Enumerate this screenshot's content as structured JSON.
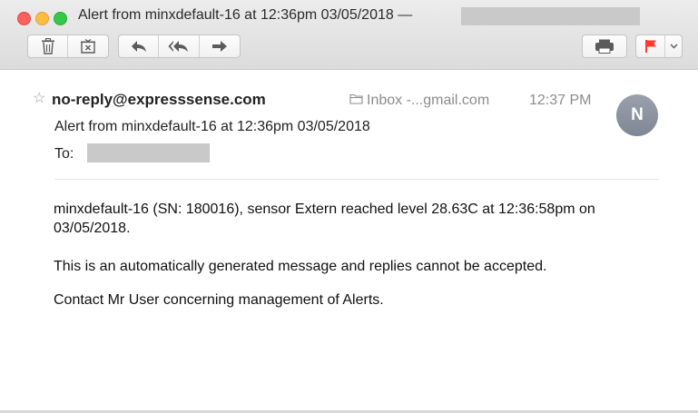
{
  "window": {
    "title": "Alert from minxdefault-16 at 12:36pm 03/05/2018 —"
  },
  "toolbar": {
    "buttons": [
      {
        "icon": "trash-icon"
      },
      {
        "icon": "junk-icon"
      },
      {
        "icon": "reply-icon"
      },
      {
        "icon": "reply-all-icon"
      },
      {
        "icon": "forward-icon"
      },
      {
        "icon": "print-icon"
      },
      {
        "icon": "flag-icon"
      },
      {
        "icon": "chevron-down-icon"
      }
    ],
    "flag_color": "#ff3b30"
  },
  "message": {
    "sender": "no-reply@expresssense.com",
    "mailbox": "Inbox -...gmail.com",
    "time": "12:37 PM",
    "avatar_initial": "N",
    "subject": "Alert from minxdefault-16 at 12:36pm 03/05/2018",
    "to_label": "To:",
    "body": [
      "minxdefault-16 (SN: 180016), sensor Extern reached level 28.63C at 12:36:58pm on 03/05/2018.",
      "This is an automatically generated message and replies cannot be accepted.",
      "Contact Mr User concerning management of Alerts."
    ]
  }
}
